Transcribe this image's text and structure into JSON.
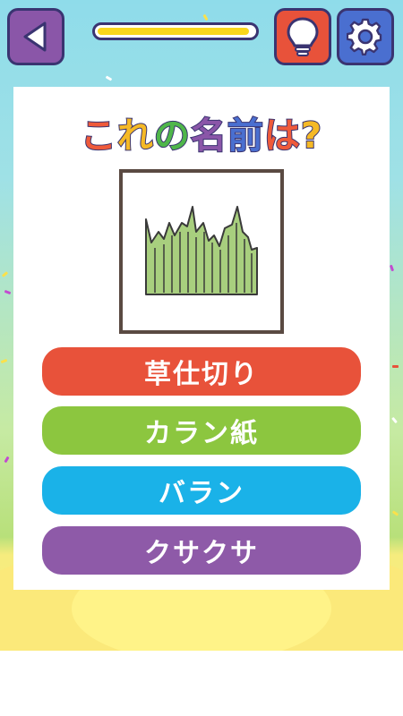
{
  "header": {
    "back_icon": "back-triangle-icon",
    "hint_icon": "lightbulb-icon",
    "settings_icon": "gear-icon",
    "progress_fraction": 0.97
  },
  "question": {
    "title_chars": [
      "こ",
      "れ",
      "の",
      "名",
      "前",
      "は",
      "?"
    ],
    "title_colors": [
      "#ef5a3a",
      "#f5b926",
      "#4fb64a",
      "#8a56a8",
      "#4a6fd0",
      "#ef5a3a",
      "#f5b926"
    ],
    "image_icon": "baran-grass-divider-illustration"
  },
  "answers": [
    {
      "label": "草仕切り",
      "color": "#e8523a"
    },
    {
      "label": "カラン紙",
      "color": "#8cc63f"
    },
    {
      "label": "バラン",
      "color": "#1ab2e8"
    },
    {
      "label": "クサクサ",
      "color": "#8e5aa8"
    }
  ]
}
